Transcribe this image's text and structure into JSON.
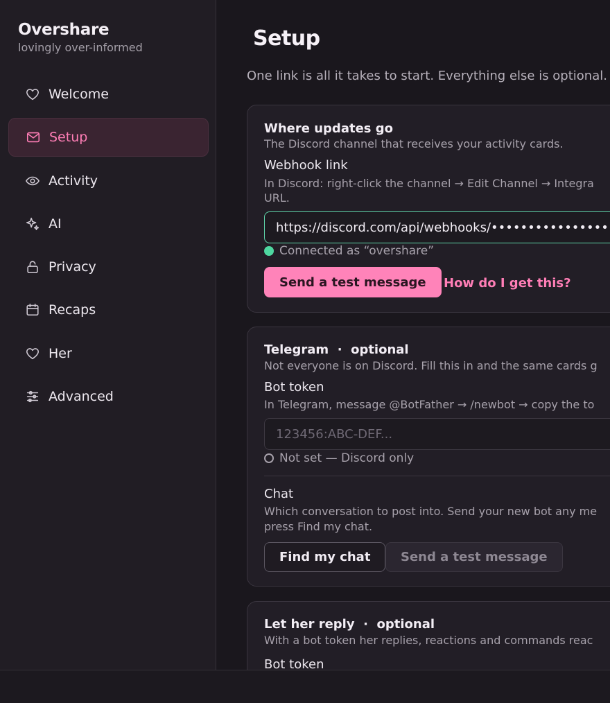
{
  "app": {
    "title": "Overshare",
    "subtitle": "lovingly over-informed"
  },
  "sidebar": {
    "items": [
      {
        "label": "Welcome",
        "icon": "heart-icon"
      },
      {
        "label": "Setup",
        "icon": "mail-icon",
        "active": true
      },
      {
        "label": "Activity",
        "icon": "eye-icon"
      },
      {
        "label": "AI",
        "icon": "sparkle-icon"
      },
      {
        "label": "Privacy",
        "icon": "lock-icon"
      },
      {
        "label": "Recaps",
        "icon": "calendar-icon"
      },
      {
        "label": "Her",
        "icon": "heart-icon"
      },
      {
        "label": "Advanced",
        "icon": "sliders-icon"
      }
    ]
  },
  "main": {
    "title": "Setup",
    "subtitle": "One link is all it takes to start. Everything else is optional."
  },
  "discord": {
    "title": "Where updates go",
    "description": "The Discord channel that receives your activity cards.",
    "webhook_label": "Webhook link",
    "webhook_help_line1": "In Discord: right-click the channel → Edit Channel → Integra",
    "webhook_help_line2": "URL.",
    "webhook_value": "https://discord.com/api/webhooks/•••••••••••••••••/••••",
    "status": "Connected as “overshare”",
    "test_button": "Send a test message",
    "help_link": "How do I get this?"
  },
  "telegram": {
    "title": "Telegram",
    "separator": "·",
    "optional": "optional",
    "description": "Not everyone is on Discord. Fill this in and the same cards g",
    "token_label": "Bot token",
    "token_help": "In Telegram, message @BotFather → /newbot → copy the to",
    "token_placeholder": "123456:ABC-DEF...",
    "token_status": "Not set — Discord only",
    "chat_label": "Chat",
    "chat_help_line1": "Which conversation to post into. Send your new bot any me",
    "chat_help_line2": "press Find my chat.",
    "find_chat_button": "Find my chat",
    "test_button": "Send a test message"
  },
  "reply": {
    "title": "Let her reply",
    "separator": "·",
    "optional": "optional",
    "description": "With a bot token her replies, reactions and commands reac",
    "token_label": "Bot token"
  },
  "colors": {
    "accent": "#ff83b9",
    "success": "#4ed7a0",
    "background": "#1a171d",
    "sidebar": "#211d24"
  }
}
